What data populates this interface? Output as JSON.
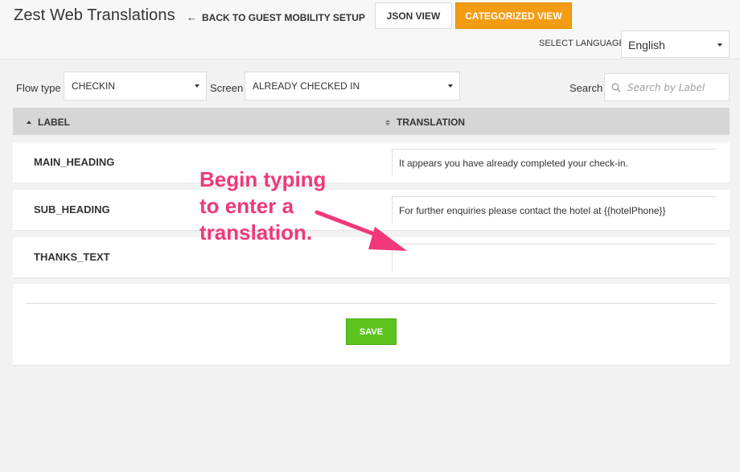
{
  "header": {
    "app_title": "Zest Web Translations",
    "back_link": "BACK TO GUEST MOBILITY SETUP",
    "json_view": "JSON VIEW",
    "categorized_view": "CATEGORIZED VIEW",
    "select_language_label": "SELECT LANGUAGE",
    "language_value": "English"
  },
  "filters": {
    "flow_type_label": "Flow type",
    "flow_type_value": "CHECKIN",
    "screen_label": "Screen",
    "screen_value": "ALREADY CHECKED IN",
    "search_label": "Search",
    "search_placeholder": "Search by Label"
  },
  "table": {
    "col_label": "LABEL",
    "col_translation": "TRANSLATION",
    "rows": [
      {
        "label": "MAIN_HEADING",
        "translation": "It appears you have already completed your check-in."
      },
      {
        "label": "SUB_HEADING",
        "translation": "For further enquiries please contact the hotel at {{hotelPhone}}"
      },
      {
        "label": "THANKS_TEXT",
        "translation": ""
      }
    ]
  },
  "save_label": "SAVE",
  "annotation": {
    "text": "Begin typing\nto enter a\ntranslation.",
    "color": "#f0387b"
  },
  "colors": {
    "accent_orange": "#f39c12",
    "save_green": "#5cc41f"
  }
}
